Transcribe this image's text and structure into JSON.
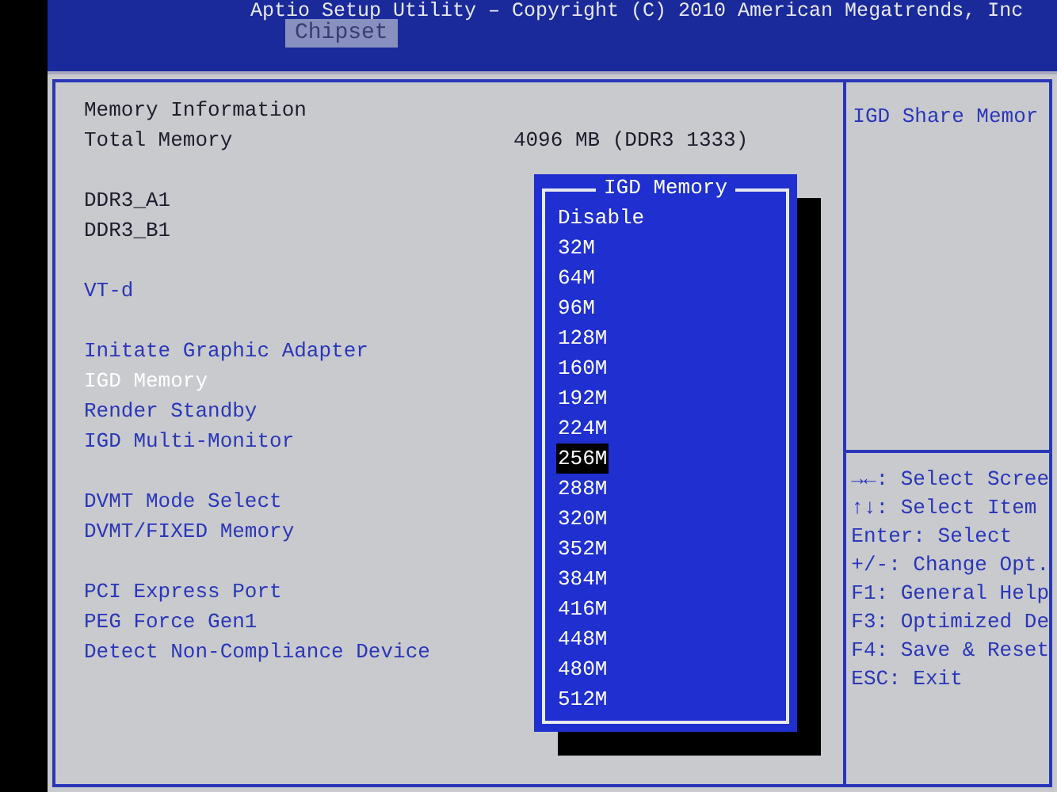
{
  "header": {
    "title": "Aptio Setup Utility – Copyright (C) 2010 American Megatrends, Inc",
    "tabs": [
      {
        "label": "Chipset",
        "selected": true
      }
    ]
  },
  "sections": [
    {
      "items": [
        {
          "label": "Memory Information",
          "kind": "info",
          "selected": false
        },
        {
          "label": "Total Memory",
          "kind": "info",
          "selected": false,
          "value": "4096 MB (DDR3 1333)"
        }
      ]
    },
    {
      "items": [
        {
          "label": "DDR3_A1",
          "kind": "info",
          "selected": false
        },
        {
          "label": "DDR3_B1",
          "kind": "info",
          "selected": false
        }
      ]
    },
    {
      "items": [
        {
          "label": "VT-d",
          "kind": "setting",
          "selected": false
        }
      ]
    },
    {
      "items": [
        {
          "label": "Initate Graphic Adapter",
          "kind": "setting",
          "selected": false
        },
        {
          "label": "IGD Memory",
          "kind": "setting",
          "selected": true
        },
        {
          "label": "Render Standby",
          "kind": "setting",
          "selected": false
        },
        {
          "label": "IGD Multi-Monitor",
          "kind": "setting",
          "selected": false
        }
      ]
    },
    {
      "items": [
        {
          "label": "DVMT Mode Select",
          "kind": "setting",
          "selected": false
        },
        {
          "label": "DVMT/FIXED Memory",
          "kind": "setting",
          "selected": false
        }
      ]
    },
    {
      "items": [
        {
          "label": "PCI Express Port",
          "kind": "setting",
          "selected": false
        },
        {
          "label": "PEG Force Gen1",
          "kind": "setting",
          "selected": false
        },
        {
          "label": "Detect Non-Compliance Device",
          "kind": "setting",
          "selected": false
        }
      ]
    }
  ],
  "popup": {
    "title": "IGD Memory",
    "options": [
      {
        "label": "Disable",
        "selected": false
      },
      {
        "label": "32M",
        "selected": false
      },
      {
        "label": "64M",
        "selected": false
      },
      {
        "label": "96M",
        "selected": false
      },
      {
        "label": "128M",
        "selected": false
      },
      {
        "label": "160M",
        "selected": false
      },
      {
        "label": "192M",
        "selected": false
      },
      {
        "label": "224M",
        "selected": false
      },
      {
        "label": "256M",
        "selected": true
      },
      {
        "label": "288M",
        "selected": false
      },
      {
        "label": "320M",
        "selected": false
      },
      {
        "label": "352M",
        "selected": false
      },
      {
        "label": "384M",
        "selected": false
      },
      {
        "label": "416M",
        "selected": false
      },
      {
        "label": "448M",
        "selected": false
      },
      {
        "label": "480M",
        "selected": false
      },
      {
        "label": "512M",
        "selected": false
      }
    ]
  },
  "help": {
    "description": "IGD Share Memor",
    "keys": [
      "→←: Select Scree",
      "↑↓: Select Item",
      "Enter: Select",
      "+/-: Change Opt.",
      "F1: General Help",
      "F3: Optimized De",
      "F4: Save & Reset",
      "ESC: Exit"
    ]
  }
}
